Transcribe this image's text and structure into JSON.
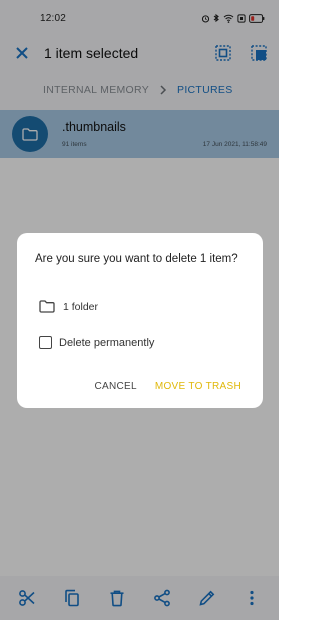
{
  "status_bar": {
    "time": "12:02",
    "icons": [
      "alarm-icon",
      "bluetooth-icon",
      "wifi-icon",
      "sim-icon",
      "battery-icon"
    ],
    "battery_color": "#e5302a"
  },
  "action_bar": {
    "title": "1 item selected",
    "icons": [
      "close-icon",
      "select-all-icon",
      "invert-selection-icon"
    ]
  },
  "breadcrumb": {
    "root": "INTERNAL MEMORY",
    "current": "PICTURES"
  },
  "files": [
    {
      "name": ".thumbnails",
      "count": "91 items",
      "date": "17 Jun 2021, 11:58:49",
      "icon": "folder-icon"
    }
  ],
  "dialog": {
    "message": "Are you sure you want to delete 1 item?",
    "summary": "1 folder",
    "checkbox_label": "Delete permanently",
    "checkbox_checked": false,
    "cancel_label": "CANCEL",
    "confirm_label": "MOVE TO TRASH"
  },
  "bottom_bar": {
    "icons": [
      "cut-icon",
      "copy-icon",
      "delete-icon",
      "share-icon",
      "rename-icon",
      "more-icon"
    ]
  },
  "colors": {
    "accent": "#1a73c4",
    "selected_row": "#a9cbe6",
    "folder_avatar": "#1e6fa9",
    "confirm_text": "#e0b80a"
  }
}
